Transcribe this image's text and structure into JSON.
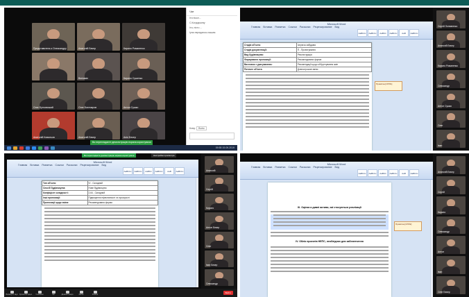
{
  "panel1": {
    "chat_title": "Чат",
    "chat_messages": [
      "Іти нікол...",
      "С.Кондарьеву",
      "Іти, ніхто ...",
      "Іуна передаюсь нашим"
    ],
    "chat_to_label": "Кому:",
    "chat_to_value": "Всем",
    "tiles": [
      "Представитель к Олександру",
      "Анатолій Бекер",
      "Кирило Романенко",
      "",
      "Веніамін",
      "Кирило Сушенко",
      "Олег Бутковський",
      "Олег Бахтиаров",
      "Антон Сушко",
      "Анатолій Ковальов",
      "Анатолій Бекер",
      "Аніл Бекер"
    ],
    "clock": "09:55",
    "date": "19.09.2019",
    "green_notice": "Ви переглядаєте демонстрацію екрана користувача"
  },
  "panel2": {
    "title": "Microsoft Word",
    "tabs": [
      "Главная",
      "Вставка",
      "Разметка",
      "Ссылки",
      "Рассылки",
      "Рецензирование",
      "Вид"
    ],
    "styles": [
      "AaBbCc",
      "AaBbCc",
      "AaBbC",
      "AaBbCc",
      "AaB",
      "AaBbCc"
    ],
    "rows": [
      [
        "Стадія об'єкта:",
        "Існуюча забудова"
      ],
      [
        "Стадія документації:",
        "П - Проектування"
      ],
      [
        "Вид будівництва:",
        "Реконструкція"
      ],
      [
        "Формування пропозиції:",
        "Рекомендована форма"
      ],
      [
        "Висновок з урахуванням:",
        "Рекомендації щодо обґрунтування змін"
      ],
      [
        "Поточне об'єкта:",
        "Довгострокові зміни"
      ]
    ],
    "comment": "Примітка [ОПЛ1]",
    "sidebar_names": [
      "Сергій Логвиненко",
      "Анатолій Бекер",
      "Кирило Романенко",
      "Олександр",
      "Антон Сушко",
      "Олег",
      "Іван"
    ]
  },
  "panel3": {
    "title": "Microsoft Word",
    "notice": "Ви переглядаєте демонстрацію екрана користувача",
    "notice2": "Настройки просмотра",
    "rows": [
      [
        "Тип об'єкта:",
        "IV - Складний"
      ],
      [
        "Спосіб будівництва:",
        "Нове будівництво"
      ],
      [
        "Коефіцієнт складності:",
        "2,64 - Складний"
      ],
      [
        "Інші пропозиції:",
        "Підвищення ефективності та прозорості"
      ],
      [
        "Пропозиції щодо зміни:",
        "Рекомендована форма"
      ]
    ],
    "toolbar": [
      "Вимкнути звук",
      "Зупинити відео",
      "Учасники",
      "Чат",
      "Демонстрація",
      "Запис",
      "Реакції"
    ],
    "end_label": "Вийти",
    "sidebar_names": [
      "Анатолій",
      "Сергій",
      "Кирило",
      "Антон Бекер",
      "Олег",
      "Іван Бекер",
      "Олександр"
    ]
  },
  "panel4": {
    "title": "Microsoft Word",
    "heading": "III. Оцінка и дивні активи, які стосуються реалізації",
    "heading2": "IV. Облік проектів НЕПС, необхідних для забезпечення",
    "comment": "Примітка [ОПЛ2]",
    "sidebar_names": [
      "Анатолій Бекер",
      "Сергій",
      "Кирило",
      "Олександр",
      "Антон",
      "Іван",
      "Олег Бекер"
    ]
  }
}
